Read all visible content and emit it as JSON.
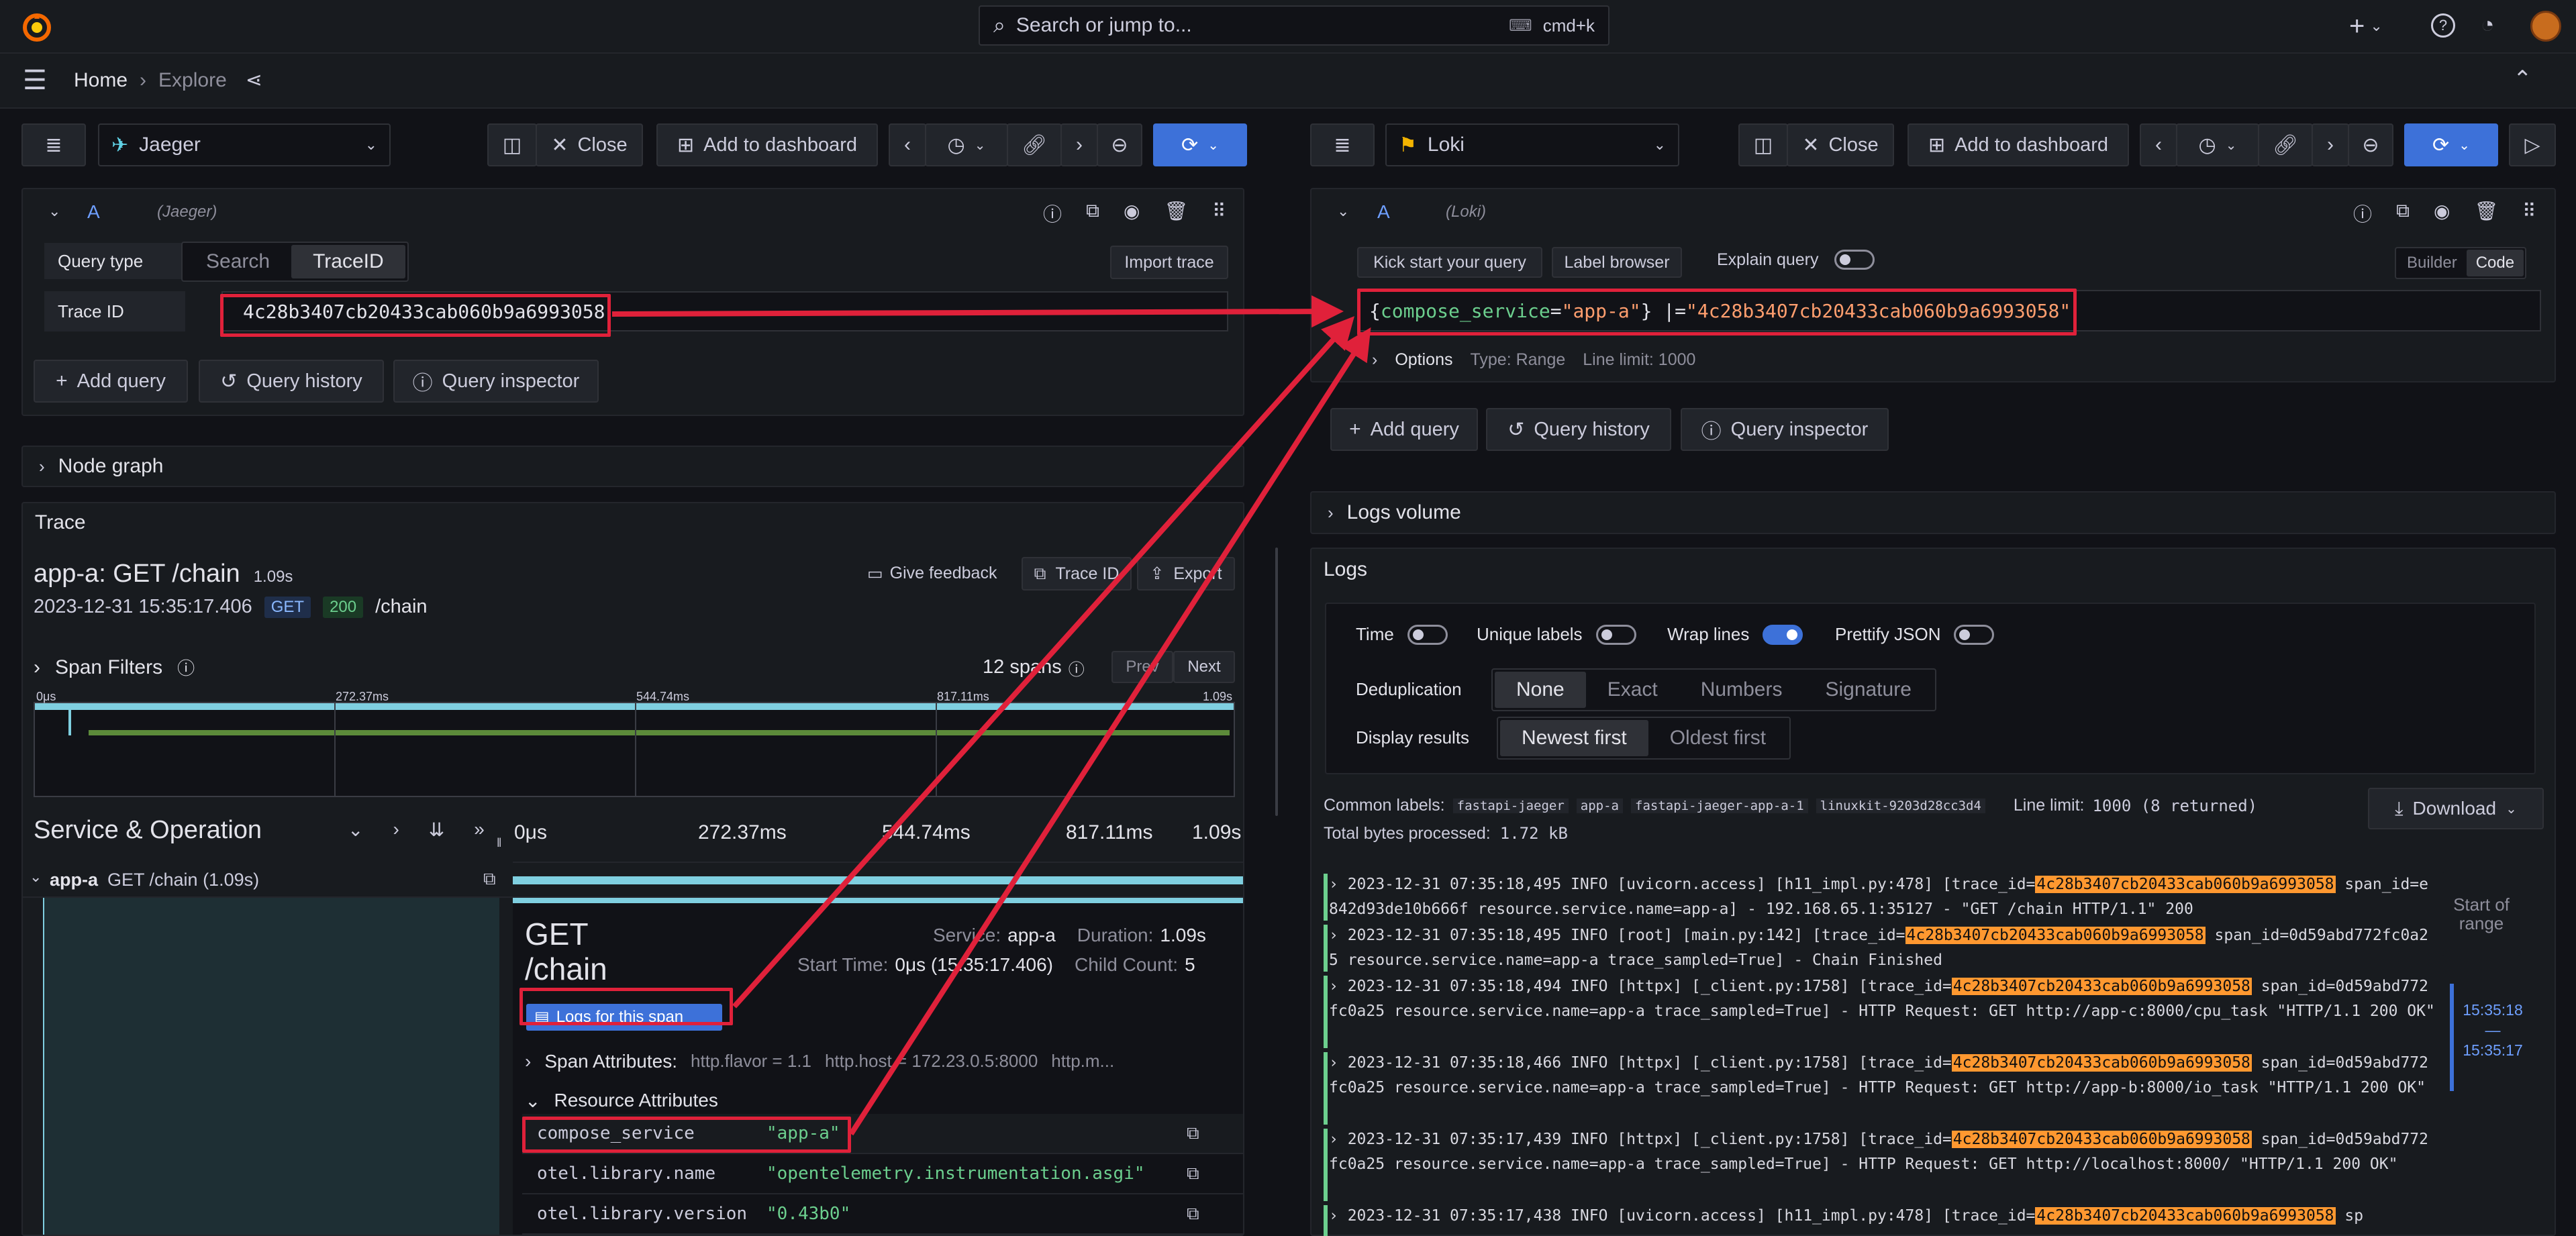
{
  "topbar": {
    "search_placeholder": "Search or jump to...",
    "shortcut": "cmd+k",
    "plus": "+"
  },
  "breadcrumb": {
    "home": "Home",
    "separator": "›",
    "current": "Explore"
  },
  "left": {
    "datasource": "Jaeger",
    "close": "Close",
    "add_to_dashboard": "Add to dashboard",
    "query": {
      "letter": "A",
      "ds_name": "(Jaeger)",
      "query_type_label": "Query type",
      "tabs": [
        "Search",
        "TraceID"
      ],
      "import_trace": "Import trace",
      "trace_id_label": "Trace ID",
      "trace_id_value": "4c28b3407cb20433cab060b9a6993058"
    },
    "add_query": "Add query",
    "query_history": "Query history",
    "query_inspector": "Query inspector",
    "node_graph": "Node graph",
    "trace": {
      "section_title": "Trace",
      "title": "app-a: GET /chain",
      "duration": "1.09s",
      "date": "2023-12-31 15:35:",
      "time_bold": "17.406",
      "method": "GET",
      "status": "200",
      "path": "/chain",
      "give_feedback": "Give feedback",
      "trace_id_btn": "Trace ID",
      "export_btn": "Export",
      "span_filters": "Span Filters",
      "spans_count": "12 spans",
      "prev": "Prev",
      "next": "Next",
      "minimap_ticks": [
        "0μs",
        "272.37ms",
        "544.74ms",
        "817.11ms",
        "1.09s"
      ],
      "service_operation": "Service & Operation",
      "timeline_ticks": [
        "0μs",
        "272.37ms",
        "544.74ms",
        "817.11ms",
        "1.09s"
      ],
      "row_service": "app-a",
      "row_op": "GET /chain (1.09s)",
      "detail": {
        "op_title_1": "GET",
        "op_title_2": "/chain",
        "service_label": "Service:",
        "service_value": "app-a",
        "duration_label": "Duration:",
        "duration_value": "1.09s",
        "start_label": "Start Time:",
        "start_value": "0μs (15:35:17.406)",
        "child_label": "Child Count:",
        "child_value": "5",
        "logs_button": "Logs for this span",
        "span_attributes": "Span Attributes:",
        "span_attr_1": "http.flavor = 1.1",
        "span_attr_2": "http.host = 172.23.0.5:8000",
        "span_attr_3": "http.m...",
        "resource_attributes": "Resource Attributes",
        "attrs": [
          {
            "key": "compose_service",
            "value": "\"app-a\""
          },
          {
            "key": "otel.library.name",
            "value": "\"opentelemetry.instrumentation.asgi\""
          },
          {
            "key": "otel.library.version",
            "value": "\"0.43b0\""
          }
        ]
      }
    }
  },
  "right": {
    "datasource": "Loki",
    "close": "Close",
    "add_to_dashboard": "Add to dashboard",
    "query": {
      "letter": "A",
      "ds_name": "(Loki)",
      "kick_start": "Kick start your query",
      "label_browser": "Label browser",
      "explain_query": "Explain query",
      "builder": "Builder",
      "code": "Code",
      "expr_open": "{",
      "expr_key": "compose_service",
      "expr_eq": "=",
      "expr_val": "\"app-a\"",
      "expr_close": "} |=",
      "expr_filter": "\"4c28b3407cb20433cab060b9a6993058\"",
      "options_label": "Options",
      "options_type": "Type: Range",
      "options_limit": "Line limit: 1000"
    },
    "add_query": "Add query",
    "query_history": "Query history",
    "query_inspector": "Query inspector",
    "logs_volume": "Logs volume",
    "logs": {
      "title": "Logs",
      "time": "Time",
      "unique_labels": "Unique labels",
      "wrap_lines": "Wrap lines",
      "prettify_json": "Prettify JSON",
      "dedup_label": "Deduplication",
      "dedup_options": [
        "None",
        "Exact",
        "Numbers",
        "Signature"
      ],
      "display_label": "Display results",
      "display_options": [
        "Newest first",
        "Oldest first"
      ],
      "common_labels_label": "Common labels:",
      "common_labels": [
        "fastapi-jaeger",
        "app-a",
        "fastapi-jaeger-app-a-1",
        "linuxkit-9203d28cc3d4"
      ],
      "line_limit": "Line limit:",
      "line_limit_value": "1000 (8 returned)",
      "total_bytes": "Total bytes processed:",
      "total_bytes_value": "1.72 kB",
      "download": "Download",
      "start_of_range": "Start of range",
      "range_top": "15:35:18",
      "range_sep": "—",
      "range_bottom": "15:35:17",
      "lines": [
        {
          "pre": "2023-12-31 07:35:18,495 INFO [uvicorn.access] [h11_impl.py:478] [trace_id=",
          "hl": "4c28b3407cb20433cab060b9a6993058",
          "post": " span_id=e842d93de10b666f resource.service.name=app-a] - 192.168.65.1:35127 - \"GET /chain HTTP/1.1\" 200"
        },
        {
          "pre": "2023-12-31 07:35:18,495 INFO [root] [main.py:142] [trace_id=",
          "hl": "4c28b3407cb20433cab060b9a6993058",
          "post": " span_id=0d59abd772fc0a25 resource.service.name=app-a trace_sampled=True] - Chain Finished"
        },
        {
          "pre": "2023-12-31 07:35:18,494 INFO [httpx] [_client.py:1758] [trace_id=",
          "hl": "4c28b3407cb20433cab060b9a6993058",
          "post": " span_id=0d59abd772fc0a25 resource.service.name=app-a trace_sampled=True] - HTTP Request: GET http://app-c:8000/cpu_task \"HTTP/1.1 200 OK\""
        },
        {
          "pre": "2023-12-31 07:35:18,466 INFO [httpx] [_client.py:1758] [trace_id=",
          "hl": "4c28b3407cb20433cab060b9a6993058",
          "post": " span_id=0d59abd772fc0a25 resource.service.name=app-a trace_sampled=True] - HTTP Request: GET http://app-b:8000/io_task \"HTTP/1.1 200 OK\""
        },
        {
          "pre": "2023-12-31 07:35:17,439 INFO [httpx] [_client.py:1758] [trace_id=",
          "hl": "4c28b3407cb20433cab060b9a6993058",
          "post": " span_id=0d59abd772fc0a25 resource.service.name=app-a trace_sampled=True] - HTTP Request: GET http://localhost:8000/ \"HTTP/1.1 200 OK\""
        },
        {
          "pre": "2023-12-31 07:35:17,438 INFO [uvicorn.access] [h11_impl.py:478] [trace_id=",
          "hl": "4c28b3407cb20433cab060b9a6993058",
          "post": " sp"
        }
      ]
    }
  },
  "colors": {
    "accent": "#3d71d9",
    "highlight": "#ff9830",
    "annotation": "#e0213a",
    "log_level_info": "#6ccf8e"
  }
}
